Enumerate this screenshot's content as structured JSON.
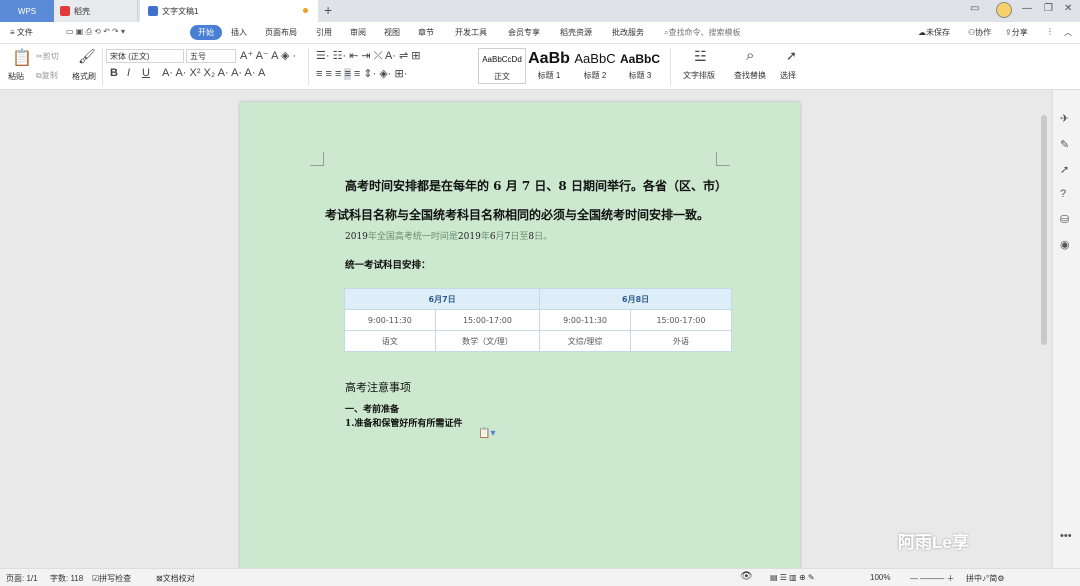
{
  "titlebar": {
    "wps_tab": "WPS",
    "shell_tab": "稻壳",
    "doc_tab": "文字文稿1",
    "new_tab": "+"
  },
  "menubar": {
    "file": "≡ 文件",
    "items": [
      "开始",
      "插入",
      "页面布局",
      "引用",
      "审阅",
      "视图",
      "章节",
      "开发工具",
      "会员专享",
      "稻壳资源",
      "批改服务"
    ],
    "search_placeholder": "查找命令、搜索模板",
    "unsaved": "未保存",
    "collab": "协作",
    "share": "分享"
  },
  "ribbon": {
    "paste": "粘贴",
    "cut": "剪切",
    "copy": "复制",
    "format_painter": "格式刷",
    "font_name": "宋体 (正文)",
    "font_size": "五号",
    "styles": [
      {
        "sample": "AaBbCcDd",
        "label": "正文"
      },
      {
        "sample": "AaBb",
        "label": "标题 1"
      },
      {
        "sample": "AaBbC",
        "label": "标题 2"
      },
      {
        "sample": "AaBbC",
        "label": "标题 3"
      }
    ],
    "text_layout": "文字排版",
    "find_replace": "查找替换",
    "select": "选择"
  },
  "document": {
    "para1": "高考时间安排都是在每年的 6 月 7 日、8 日期间举行。各省（区、市）",
    "para2": "考试科目名称与全国统考科目名称相同的必须与全国统考时间安排一致。",
    "para3_a": "2019",
    "para3_b": "年全国高考统一时间是",
    "para3_c": "2019",
    "para3_d": "年",
    "para3_e": "6",
    "para3_f": "月",
    "para3_g": "7",
    "para3_h": "日至",
    "para3_i": "8",
    "para3_j": "日。",
    "para4": "统一考试科目安排：",
    "table": {
      "headers": [
        "6月7日",
        "6月8日"
      ],
      "times": [
        "9:00-11:30",
        "15:00-17:00",
        "9:00-11:30",
        "15:00-17:00"
      ],
      "subjects": [
        "语文",
        "数学（文/理）",
        "文综/理综",
        "外语"
      ]
    },
    "heading2": "高考注意事项",
    "sub1": "一、考前准备",
    "sub2": "1.准备和保管好所有所需证件"
  },
  "statusbar": {
    "page": "页面: 1/1",
    "words": "字数: 118",
    "spell": "拼写检查",
    "proof": "文档校对",
    "zoom": "100%"
  },
  "watermark": "阿雨Le享"
}
